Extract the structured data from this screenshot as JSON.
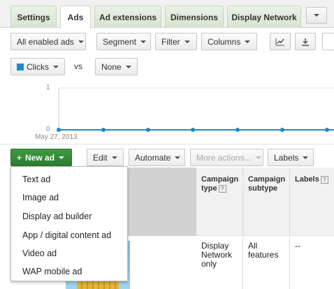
{
  "tabs": [
    {
      "label": "Settings"
    },
    {
      "label": "Ads"
    },
    {
      "label": "Ad extensions"
    },
    {
      "label": "Dimensions"
    },
    {
      "label": "Display Network"
    }
  ],
  "toolbar": {
    "filter_ads": "All enabled ads",
    "segment": "Segment",
    "filter": "Filter",
    "columns": "Columns"
  },
  "compare": {
    "metric1": "Clicks",
    "metric1_color": "#1a8bc7",
    "vs": "vs",
    "metric2": "None"
  },
  "chart_data": {
    "type": "line",
    "x_label_shown": "May 27, 2013",
    "y_ticks": [
      "1",
      "0"
    ],
    "ylim": [
      0,
      1
    ],
    "series": [
      {
        "values": [
          0,
          0,
          0,
          0,
          0,
          0,
          0
        ]
      }
    ],
    "color": "#1a8bc7"
  },
  "actions": {
    "new_ad": "New ad",
    "edit": "Edit",
    "automate": "Automate",
    "more_actions": "More actions...",
    "labels": "Labels"
  },
  "new_ad_menu": [
    "Text ad",
    "Image ad",
    "Display ad builder",
    "App / digital content ad",
    "Video ad",
    "WAP mobile ad"
  ],
  "table": {
    "headers": {
      "campaign_type": "Campaign type",
      "campaign_subtype": "Campaign subtype",
      "labels": "Labels"
    },
    "help_mark": "?",
    "row": {
      "campaign_type": "Display Network only",
      "campaign_subtype": "All features",
      "labels": "--"
    }
  }
}
